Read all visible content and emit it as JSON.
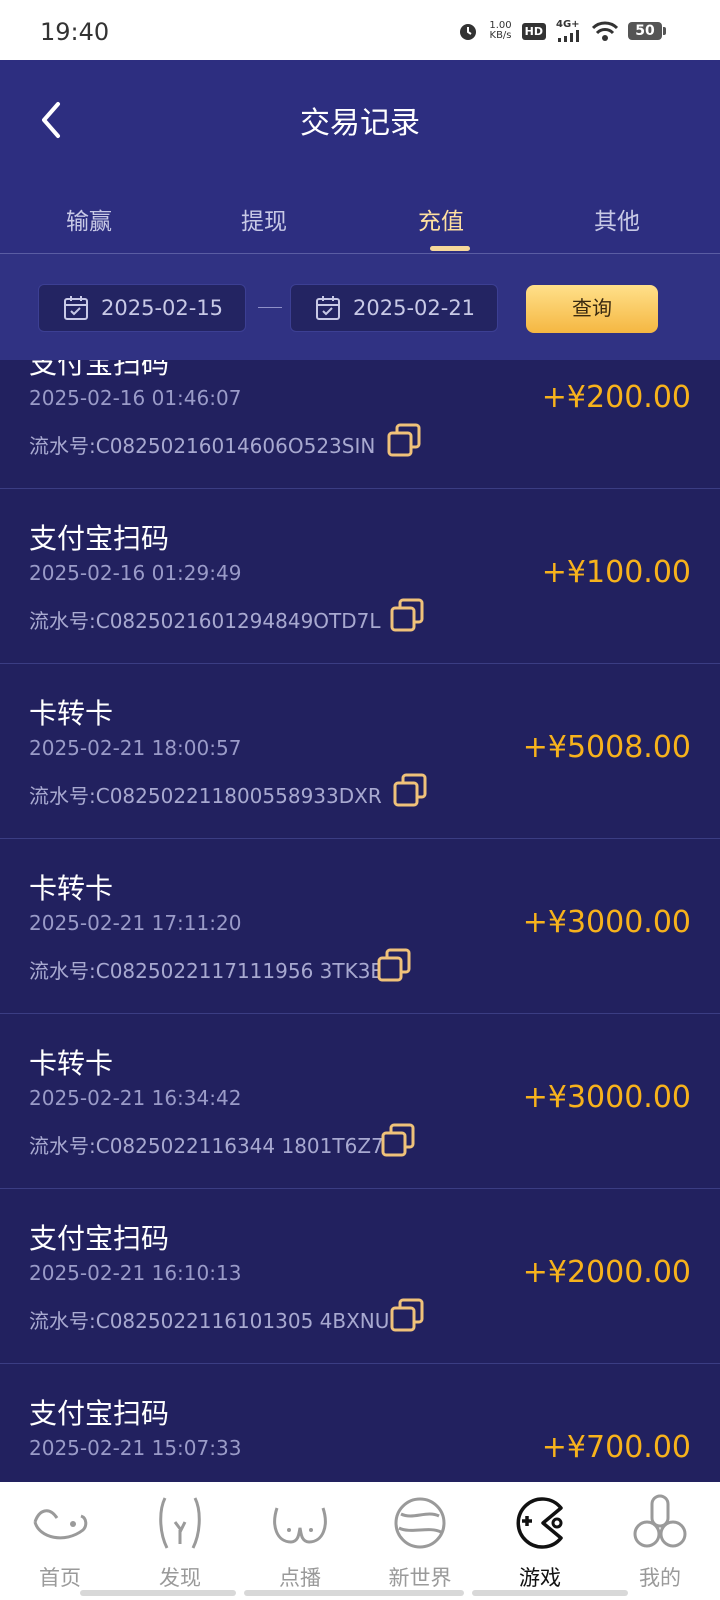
{
  "status_bar": {
    "time": "19:40",
    "net_speed_value": "1.00",
    "net_speed_unit": "KB/s",
    "hd": "HD",
    "network": "4G+",
    "battery": "50"
  },
  "header": {
    "title": "交易记录"
  },
  "tabs": [
    {
      "label": "输赢"
    },
    {
      "label": "提现"
    },
    {
      "label": "充值",
      "active": true
    },
    {
      "label": "其他"
    }
  ],
  "filter": {
    "start_date": "2025-02-15",
    "end_date": "2025-02-21",
    "query_label": "查询"
  },
  "records": [
    {
      "title": "支付宝扫码",
      "time": "2025-02-16 01:46:07",
      "serial": "流水号:C08250216014606O523SIN",
      "amount": "+¥200.00"
    },
    {
      "title": "支付宝扫码",
      "time": "2025-02-16 01:29:49",
      "serial": "流水号:C0825021601294849OTD7L",
      "amount": "+¥100.00"
    },
    {
      "title": "卡转卡",
      "time": "2025-02-21 18:00:57",
      "serial": "流水号:C082502211800558933DXR",
      "amount": "+¥5008.00"
    },
    {
      "title": "卡转卡",
      "time": "2025-02-21 17:11:20",
      "serial": "流水号:C0825022117111956 3TK3E",
      "amount": "+¥3000.00"
    },
    {
      "title": "卡转卡",
      "time": "2025-02-21 16:34:42",
      "serial": "流水号:C0825022116344 1801T6Z7",
      "amount": "+¥3000.00"
    },
    {
      "title": "支付宝扫码",
      "time": "2025-02-21 16:10:13",
      "serial": "流水号:C0825022116101305 4BXNU",
      "amount": "+¥2000.00"
    },
    {
      "title": "支付宝扫码",
      "time": "2025-02-21 15:07:33",
      "serial": "",
      "amount": "+¥700.00"
    }
  ],
  "bottom_nav": [
    {
      "label": "首页",
      "icon": "home-icon"
    },
    {
      "label": "发现",
      "icon": "discover-icon"
    },
    {
      "label": "点播",
      "icon": "vod-icon"
    },
    {
      "label": "新世界",
      "icon": "planet-icon"
    },
    {
      "label": "游戏",
      "icon": "game-icon",
      "active": true
    },
    {
      "label": "我的",
      "icon": "profile-icon"
    }
  ],
  "colors": {
    "header_bg": "#2d2e80",
    "list_bg": "#22215f",
    "amount": "#f7b21c",
    "active_tab": "#ffe0a0",
    "query_button": "#f5b742"
  }
}
